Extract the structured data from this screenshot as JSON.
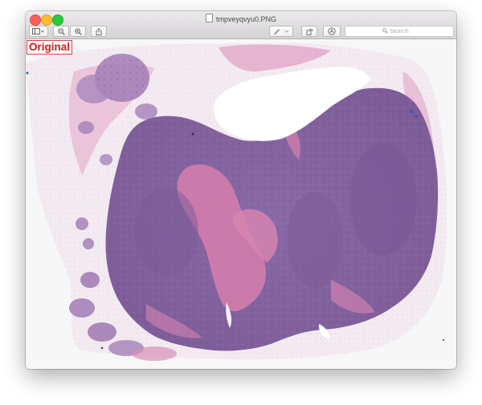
{
  "window": {
    "title": "tmpveyqvyu0.PNG",
    "toolbar": {
      "sidebar_icon": "sidebar-toggle-icon",
      "zoom_out_icon": "zoom-out-icon",
      "zoom_in_icon": "zoom-in-icon",
      "share_icon": "share-icon",
      "markup_icon": "markup-pen-icon",
      "rotate_icon": "rotate-icon",
      "annotate_icon": "annotate-icon",
      "search_placeholder": "Search"
    }
  },
  "image": {
    "label": "Original",
    "subject": "histology slide tissue section",
    "colors": {
      "tissue_purple": "#8e6aa6",
      "tissue_pink": "#d27aa8",
      "label_red": "#d81818"
    }
  }
}
